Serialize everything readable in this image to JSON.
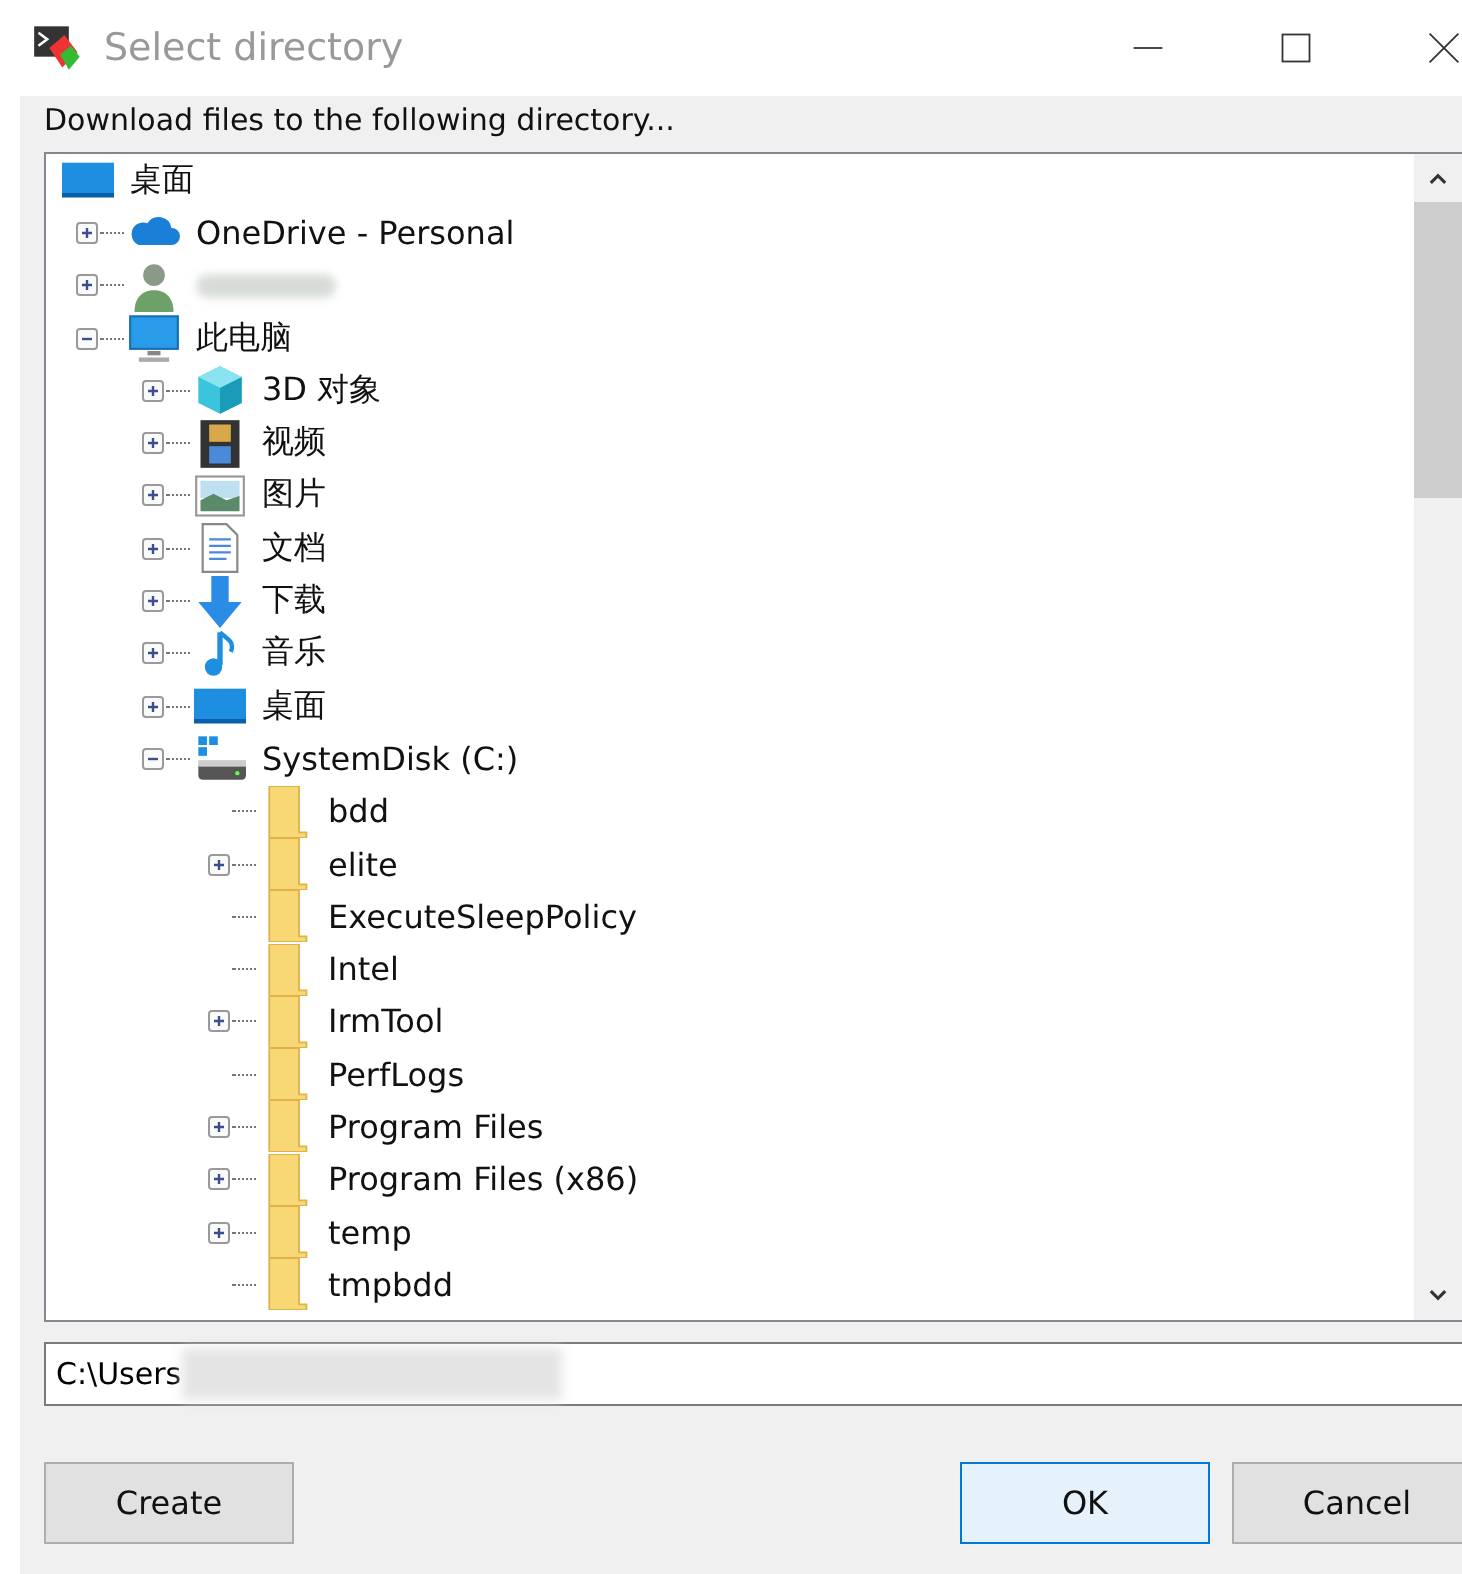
{
  "window": {
    "title": "Select directory"
  },
  "prompt": "Download files to the following directory...",
  "tree": [
    {
      "label": "桌面",
      "kind": "desktop",
      "selected": false,
      "children": [
        {
          "label": "OneDrive - Personal",
          "kind": "cloud",
          "expanded": false,
          "selected": false
        },
        {
          "kind": "user",
          "redacted": true,
          "expanded": false,
          "selected": false
        },
        {
          "label": "此电脑",
          "kind": "computer",
          "expanded": true,
          "selected": false,
          "children": [
            {
              "label": "3D 对象",
              "kind": "cube",
              "expanded": false,
              "selected": false
            },
            {
              "label": "视频",
              "kind": "video",
              "expanded": false,
              "selected": false
            },
            {
              "label": "图片",
              "kind": "image",
              "expanded": false,
              "selected": false
            },
            {
              "label": "文档",
              "kind": "document",
              "expanded": false,
              "selected": false
            },
            {
              "label": "下载",
              "kind": "download",
              "expanded": false,
              "selected": false
            },
            {
              "label": "音乐",
              "kind": "music",
              "expanded": false,
              "selected": false
            },
            {
              "label": "桌面",
              "kind": "desktop",
              "expanded": false,
              "selected": false
            },
            {
              "label": "SystemDisk (C:)",
              "kind": "drive",
              "expanded": true,
              "selected": false,
              "children": [
                {
                  "label": "bdd",
                  "kind": "folder",
                  "selected": false
                },
                {
                  "label": "elite",
                  "kind": "folder",
                  "expanded": false,
                  "selected": false
                },
                {
                  "label": "ExecuteSleepPolicy",
                  "kind": "folder",
                  "selected": false
                },
                {
                  "label": "Intel",
                  "kind": "folder",
                  "selected": false
                },
                {
                  "label": "IrmTool",
                  "kind": "folder",
                  "expanded": false,
                  "selected": false
                },
                {
                  "label": "PerfLogs",
                  "kind": "folder",
                  "selected": false
                },
                {
                  "label": "Program Files",
                  "kind": "folder",
                  "expanded": false,
                  "selected": false
                },
                {
                  "label": "Program Files (x86)",
                  "kind": "folder",
                  "expanded": false,
                  "selected": false
                },
                {
                  "label": "temp",
                  "kind": "folder",
                  "expanded": false,
                  "selected": false
                },
                {
                  "label": "tmpbdd",
                  "kind": "folder",
                  "selected": false
                }
              ]
            }
          ]
        }
      ]
    }
  ],
  "path_field": {
    "value": "C:\\Users",
    "redacted": true
  },
  "buttons": [
    {
      "label": "Create",
      "kind": "create",
      "default": false
    },
    {
      "label": "OK",
      "kind": "ok",
      "default": true
    },
    {
      "label": "Cancel",
      "kind": "cancel",
      "default": false
    }
  ]
}
